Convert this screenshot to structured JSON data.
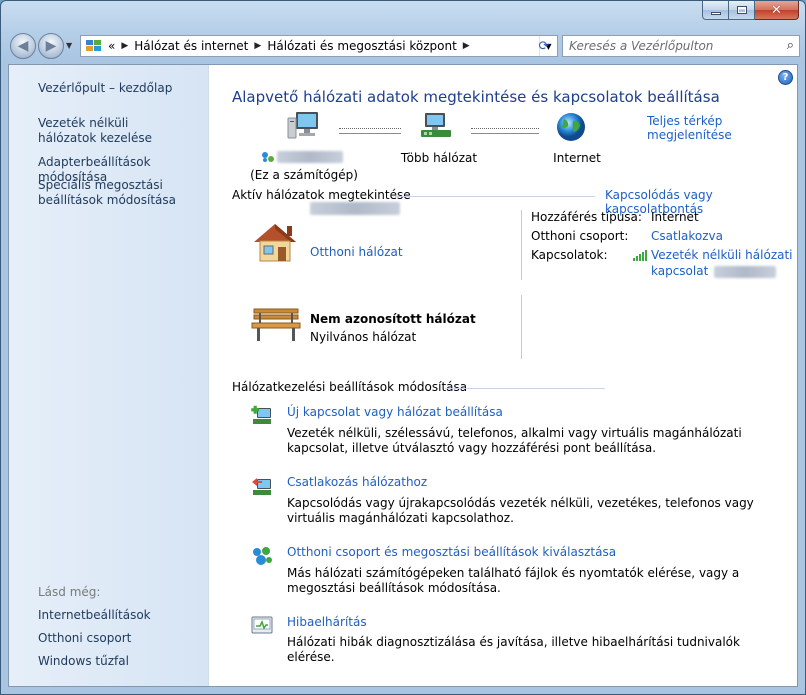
{
  "address": {
    "crumb_prefix": "«",
    "crumbs": [
      "Hálózat és internet",
      "Hálózati és megosztási központ"
    ]
  },
  "search": {
    "placeholder": "Keresés a Vezérlőpulton"
  },
  "sidebar": {
    "home": "Vezérlőpult – kezdőlap",
    "links": [
      "Vezeték nélküli hálózatok kezelése",
      "Adapterbeállítások módosítása",
      "Speciális megosztási beállítások módosítása"
    ],
    "see_also_label": "Lásd még:",
    "see_also": [
      "Internetbeállítások",
      "Otthoni csoport",
      "Windows tűzfal"
    ]
  },
  "main": {
    "title": "Alapvető hálózati adatok megtekintése és kapcsolatok beállítása",
    "full_map": "Teljes térkép megjelenítése",
    "map": {
      "computer_label": "(Ez a számítógép)",
      "network_label": "Több hálózat",
      "internet_label": "Internet"
    },
    "active_header": "Aktív hálózatok megtekintése",
    "connect_link": "Kapcsolódás vagy kapcsolatbontás",
    "networks": [
      {
        "name": "Otthoni hálózat",
        "type": ""
      },
      {
        "name": "Nem azonosított hálózat",
        "type": "Nyilvános hálózat"
      }
    ],
    "details": {
      "access_key": "Hozzáférés típusa:",
      "access_val": "Internet",
      "homegroup_key": "Otthoni csoport:",
      "homegroup_val": "Csatlakozva",
      "connections_key": "Kapcsolatok:",
      "connection_line1": "Vezeték nélküli hálózati",
      "connection_line2": "kapcsolat"
    },
    "settings_header": "Hálózatkezelési beállítások módosítása",
    "tasks": [
      {
        "title": "Új kapcsolat vagy hálózat beállítása",
        "desc": "Vezeték nélküli, szélessávú, telefonos, alkalmi vagy virtuális magánhálózati kapcsolat, illetve útválasztó vagy hozzáférési pont beállítása."
      },
      {
        "title": "Csatlakozás hálózathoz",
        "desc": "Kapcsolódás vagy újrakapcsolódás vezeték nélküli, vezetékes, telefonos vagy virtuális magánhálózati kapcsolathoz."
      },
      {
        "title": "Otthoni csoport és megosztási beállítások kiválasztása",
        "desc": "Más hálózati számítógépeken található fájlok és nyomtatók elérése, vagy a megosztási beállítások módosítása."
      },
      {
        "title": "Hibaelhárítás",
        "desc": "Hálózati hibák diagnosztizálása és javítása, illetve hibaelhárítási tudnivalók elérése."
      }
    ]
  },
  "colors": {
    "link": "#1e5fc4",
    "title": "#1e3f8c",
    "sidebar_link": "#1e395b"
  }
}
